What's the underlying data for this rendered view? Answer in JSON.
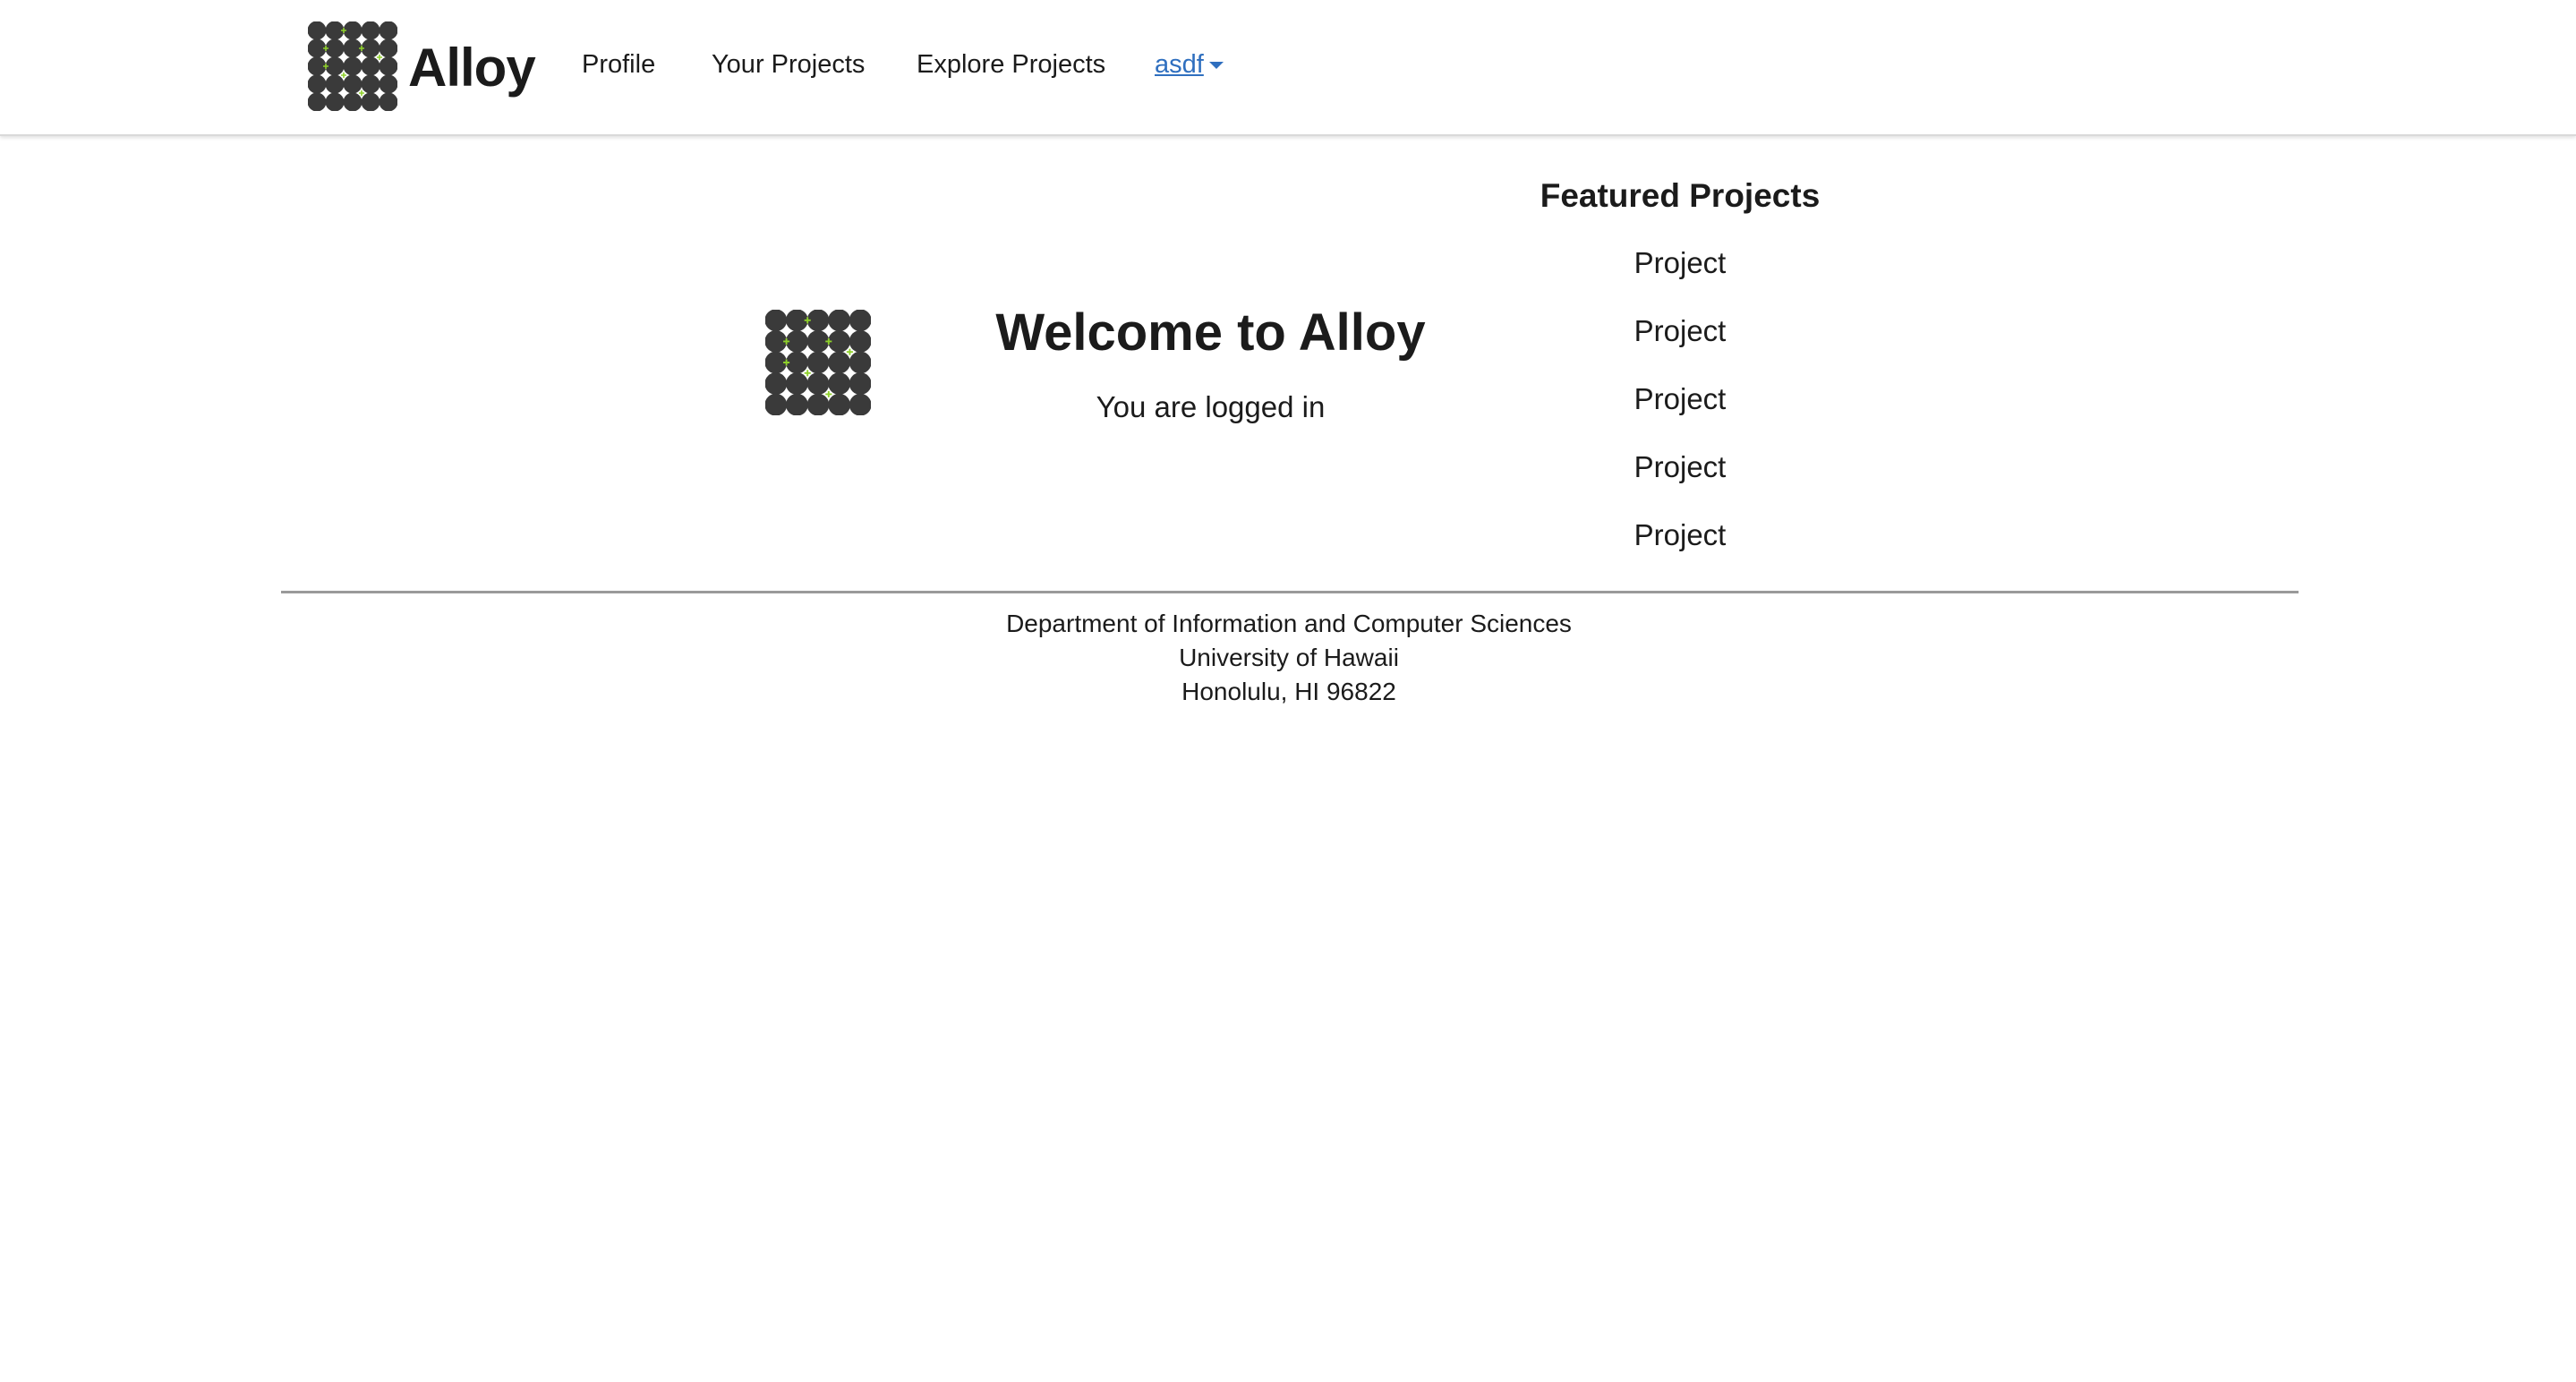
{
  "navbar": {
    "brand_name": "Alloy",
    "brand_icon": "alloy-logo-icon",
    "links": {
      "profile": "Profile",
      "your_projects": "Your Projects",
      "explore_projects": "Explore Projects"
    },
    "user_menu": {
      "label": "asdf",
      "icon": "caret-down-icon"
    }
  },
  "main": {
    "title": "Welcome to Alloy",
    "subtitle": "You are logged in",
    "logo_icon": "alloy-logo-icon"
  },
  "featured": {
    "title": "Featured Projects",
    "items": [
      "Project",
      "Project",
      "Project",
      "Project",
      "Project"
    ]
  },
  "footer": {
    "line1": "Department of Information and Computer Sciences",
    "line2": "University of Hawaii",
    "line3": "Honolulu, HI 96822"
  },
  "colors": {
    "logo_dot": "#3a3a3a",
    "logo_accent": "#8fd12b",
    "link_active": "#2f6fbf",
    "text": "#1b1b1b",
    "divider": "#9a9a9a"
  }
}
